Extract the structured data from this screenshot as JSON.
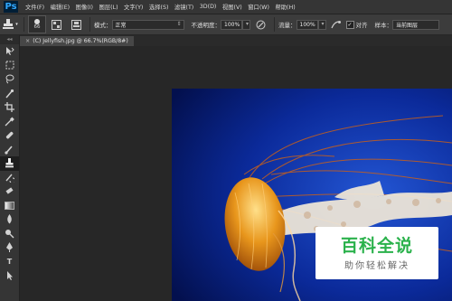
{
  "app": {
    "logo": "Ps"
  },
  "menu": [
    "文件(F)",
    "编辑(E)",
    "图像(I)",
    "图层(L)",
    "文字(Y)",
    "选择(S)",
    "滤镜(T)",
    "3D(D)",
    "视图(V)",
    "窗口(W)",
    "帮助(H)"
  ],
  "options": {
    "brush_size": "66",
    "mode_label": "模式：",
    "mode_value": "正常",
    "opacity_label": "不透明度：",
    "opacity_value": "100%",
    "flow_label": "流量：",
    "flow_value": "100%",
    "align_label": "对齐",
    "align_checked": "✓",
    "sample_label": "样本：",
    "sample_value": "当前图层"
  },
  "document": {
    "tab_close": "×",
    "tab_title": "(C) Jellyfish.jpg @ 66.7%(RGB/8#)"
  },
  "toolbar": {
    "header": "◂◂",
    "tools": [
      "move-tool",
      "marquee-tool",
      "lasso-tool",
      "quick-select-tool",
      "crop-tool",
      "eyedropper-tool",
      "healing-tool",
      "brush-tool",
      "clone-stamp-tool",
      "history-brush-tool",
      "eraser-tool",
      "gradient-tool",
      "blur-tool",
      "dodge-tool",
      "pen-tool",
      "type-tool",
      "path-select-tool"
    ]
  },
  "watermark": {
    "title": "百科全说",
    "subtitle": "助你轻松解决"
  },
  "colors": {
    "accent": "#31a8ff",
    "water_dark": "#030f46",
    "water_light": "#1d4fc7",
    "jelly": "#e0901c",
    "watermark_green": "#2bb24c"
  }
}
